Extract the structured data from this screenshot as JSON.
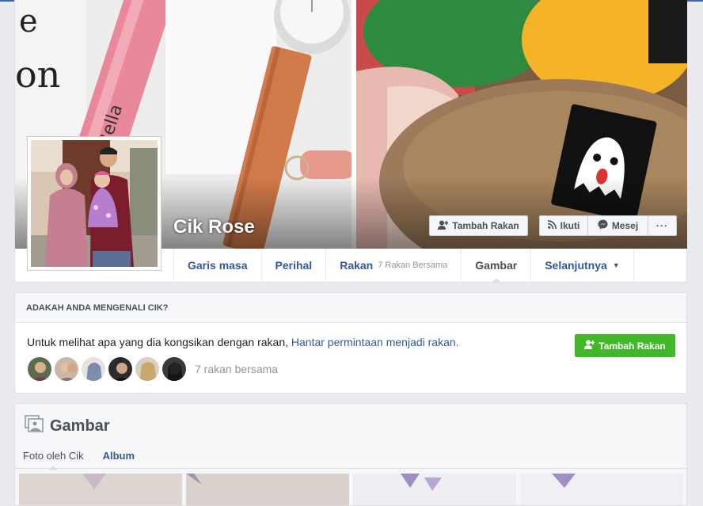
{
  "profile": {
    "name": "Cik Rose"
  },
  "cover_buttons": {
    "add_friend": "Tambah Rakan",
    "follow": "Ikuti",
    "message": "Mesej",
    "more": "···"
  },
  "tabs": [
    {
      "label": "Garis masa"
    },
    {
      "label": "Perihal"
    },
    {
      "label": "Rakan",
      "sub": "7 Rakan Bersama"
    },
    {
      "label": "Gambar"
    },
    {
      "label": "Selanjutnya"
    }
  ],
  "know": {
    "heading": "ADAKAH ANDA MENGENALI CIK?",
    "text": "Untuk melihat apa yang dia kongsikan dengan rakan, ",
    "link": "Hantar permintaan menjadi rakan.",
    "button": "Tambah Rakan",
    "mutual_count": "7 rakan bersama"
  },
  "gambar": {
    "title": "Gambar",
    "tab_photos_of": "Foto oleh Cik",
    "tab_album": "Album"
  },
  "colors": {
    "fb_blue": "#4267b2",
    "link": "#365899",
    "green": "#42b72a"
  },
  "icons": [
    "add-friend-icon",
    "rss-icon",
    "messenger-icon",
    "more-icon",
    "photos-icon",
    "dropdown-caret-icon"
  ]
}
